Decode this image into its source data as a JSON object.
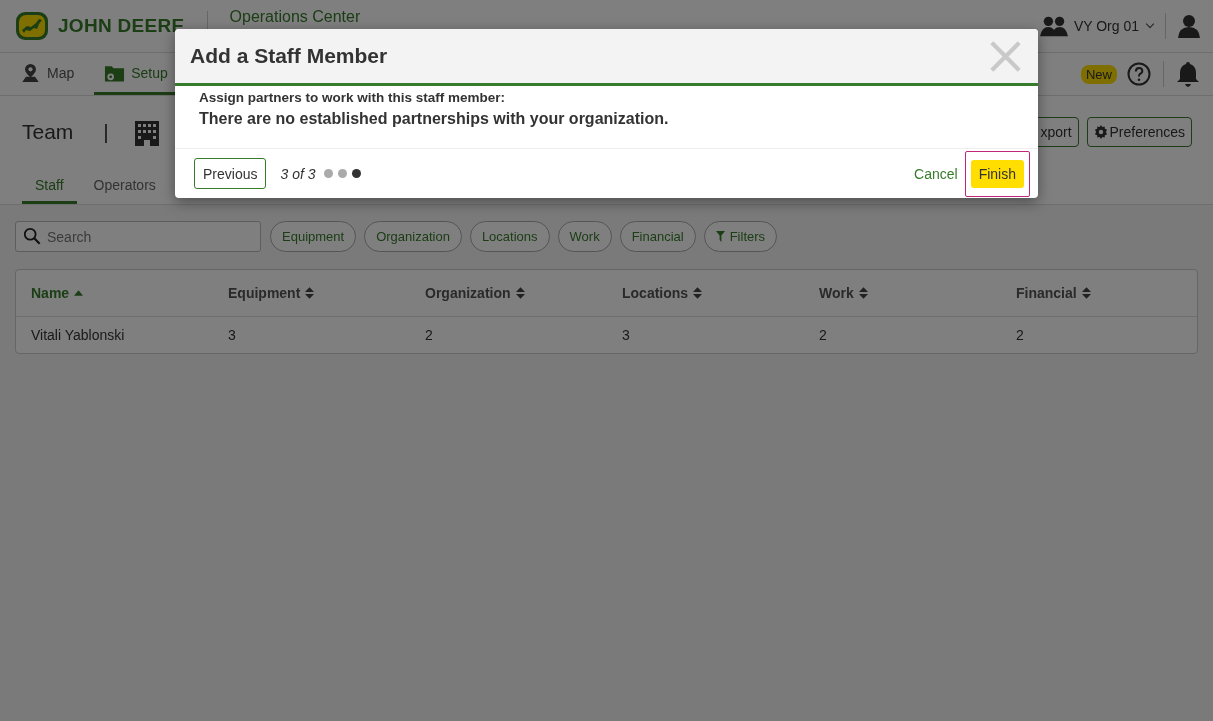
{
  "header": {
    "brand": "JOHN DEERE",
    "app_title": "Operations Center",
    "org": "VY Org 01"
  },
  "nav": {
    "items": [
      {
        "label": "Map",
        "kind": "map",
        "selected": false
      },
      {
        "label": "Setup",
        "kind": "setup",
        "selected": true
      }
    ],
    "new_badge": "New"
  },
  "page": {
    "title": "Team",
    "separator": "|",
    "buttons": [
      {
        "label": "xport",
        "kind": "plain"
      },
      {
        "label": "Preferences",
        "kind": "gear"
      }
    ]
  },
  "tabs": [
    {
      "label": "Staff",
      "selected": true
    },
    {
      "label": "Operators",
      "selected": false
    }
  ],
  "search": {
    "placeholder": "Search"
  },
  "filters": [
    "Equipment",
    "Organization",
    "Locations",
    "Work",
    "Financial"
  ],
  "filters_button": "Filters",
  "table": {
    "columns": [
      {
        "label": "Name",
        "sorted": true
      },
      {
        "label": "Equipment",
        "sorted": false
      },
      {
        "label": "Organization",
        "sorted": false
      },
      {
        "label": "Locations",
        "sorted": false
      },
      {
        "label": "Work",
        "sorted": false
      },
      {
        "label": "Financial",
        "sorted": false
      }
    ],
    "rows": [
      [
        "Vitali Yablonski",
        "3",
        "2",
        "3",
        "2",
        "2"
      ]
    ]
  },
  "dialog": {
    "title": "Add a Staff Member",
    "prompt": "Assign partners to work with this staff member:",
    "message": "There are no established partnerships with your organization.",
    "previous": "Previous",
    "step": "3 of 3",
    "steps": [
      {
        "selected": false
      },
      {
        "selected": false
      },
      {
        "selected": true
      }
    ],
    "cancel": "Cancel",
    "finish": {
      "label": "Finish",
      "focused": true
    }
  }
}
